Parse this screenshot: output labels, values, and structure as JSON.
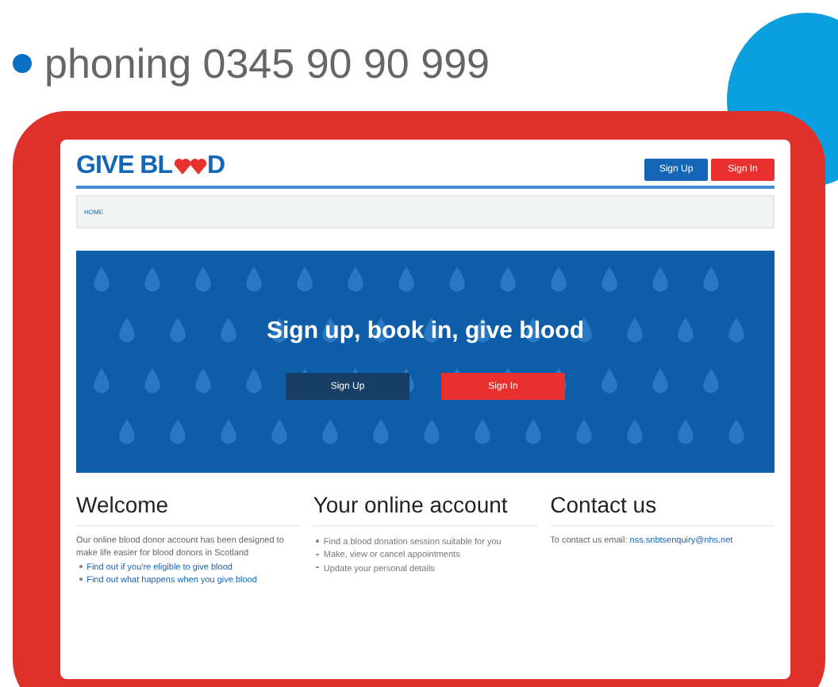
{
  "slide_bullet": {
    "text": "phoning 0345 90 90 999"
  },
  "site": {
    "logo": {
      "before": "GIVE BL",
      "after": "D"
    },
    "header_buttons": [
      {
        "label": "Sign Up",
        "kind": "primary"
      },
      {
        "label": "Sign In",
        "kind": "danger"
      }
    ],
    "breadcrumb": "HOME",
    "hero": {
      "title": "Sign up, book in, give blood",
      "buttons": [
        {
          "label": "Sign Up",
          "kind": "dark"
        },
        {
          "label": "Sign In",
          "kind": "danger"
        }
      ]
    },
    "columns": [
      {
        "heading": "Welcome",
        "paragraph": "Our online blood donor account has been designed to make life easier for blood donors in Scotland",
        "items": [
          {
            "text": "Find out if you're eligible to give blood",
            "kind": "link"
          },
          {
            "text": "Find out what happens when you give blood",
            "kind": "link"
          }
        ]
      },
      {
        "heading": "Your online account",
        "items": [
          {
            "text": "Find a blood donation session suitable for you",
            "kind": "plain"
          },
          {
            "text": "Make, view or cancel appointments",
            "kind": "plain"
          },
          {
            "text": "Update your personal details",
            "kind": "plain"
          }
        ]
      },
      {
        "heading": "Contact us",
        "contact": {
          "label": "To contact us email:",
          "email": "nss.snbtsenquiry@nhs.net"
        }
      }
    ]
  }
}
